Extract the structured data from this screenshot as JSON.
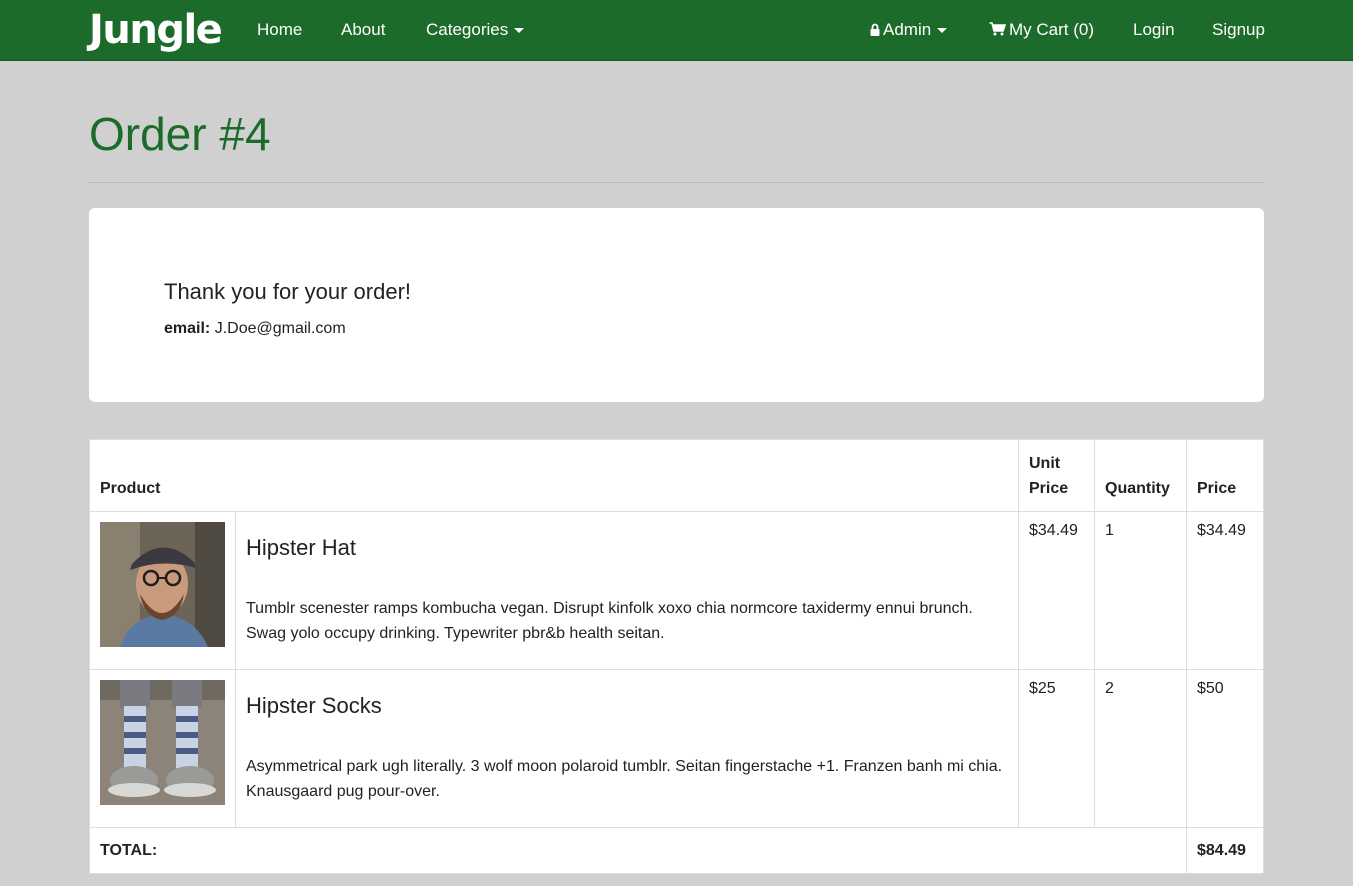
{
  "nav": {
    "brand": "Jungle",
    "home": "Home",
    "about": "About",
    "categories": "Categories",
    "admin": "Admin",
    "cart": "My Cart (0)",
    "login": "Login",
    "signup": "Signup",
    "brand_color": "#1c6b2b"
  },
  "page": {
    "title": "Order #4"
  },
  "thanks": {
    "message": "Thank you for your order!",
    "email_label": "email:",
    "email_value": "J.Doe@gmail.com"
  },
  "table": {
    "headers": {
      "product": "Product",
      "unit_price": "Unit Price",
      "quantity": "Quantity",
      "price": "Price"
    },
    "rows": [
      {
        "name": "Hipster Hat",
        "description": "Tumblr scenester ramps kombucha vegan. Disrupt kinfolk xoxo chia normcore taxidermy ennui brunch. Swag yolo occupy drinking. Typewriter pbr&b health seitan.",
        "unit_price": "$34.49",
        "quantity": "1",
        "price": "$34.49"
      },
      {
        "name": "Hipster Socks",
        "description": "Asymmetrical park ugh literally. 3 wolf moon polaroid tumblr. Seitan fingerstache +1. Franzen banh mi chia. Knausgaard pug pour-over.",
        "unit_price": "$25",
        "quantity": "2",
        "price": "$50"
      }
    ],
    "total_label": "TOTAL:",
    "total_value": "$84.49"
  }
}
